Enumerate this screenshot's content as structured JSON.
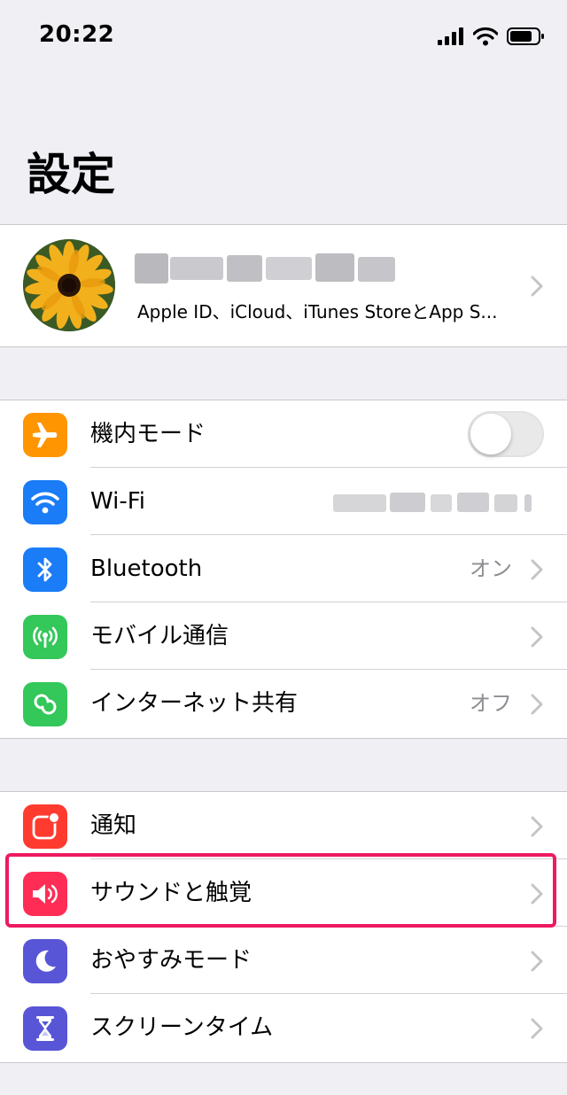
{
  "status_bar": {
    "time": "20:22",
    "icons": [
      "cellular-signal-icon",
      "wifi-status-icon",
      "battery-icon"
    ]
  },
  "header": {
    "title": "設定"
  },
  "profile": {
    "name": "",
    "subtitle": "Apple ID、iCloud、iTunes StoreとApp S...",
    "avatar": "sunflower-avatar"
  },
  "connectivity": [
    {
      "label": "機内モード",
      "icon": "airplane-icon",
      "color": "#ff9500",
      "control": "toggle",
      "toggle_on": false
    },
    {
      "label": "Wi-Fi",
      "icon": "wifi-icon",
      "color": "#1a7cf7",
      "value": ""
    },
    {
      "label": "Bluetooth",
      "icon": "bluetooth-icon",
      "color": "#1a7cf7",
      "value": "オン"
    },
    {
      "label": "モバイル通信",
      "icon": "cellular-icon",
      "color": "#34c759",
      "value": ""
    },
    {
      "label": "インターネット共有",
      "icon": "hotspot-icon",
      "color": "#34c759",
      "value": "オフ"
    }
  ],
  "general": [
    {
      "label": "通知",
      "icon": "notifications-icon",
      "color": "#ff3b30"
    },
    {
      "label": "サウンドと触覚",
      "icon": "sound-icon",
      "color": "#ff2d55",
      "highlighted": true
    },
    {
      "label": "おやすみモード",
      "icon": "moon-icon",
      "color": "#5856d6"
    },
    {
      "label": "スクリーンタイム",
      "icon": "hourglass-icon",
      "color": "#5856d6"
    }
  ],
  "colors": {
    "background": "#efeff4",
    "separator": "#d1d1d6",
    "secondary_text": "#8e8e93",
    "highlight": "#ee1a5f"
  }
}
